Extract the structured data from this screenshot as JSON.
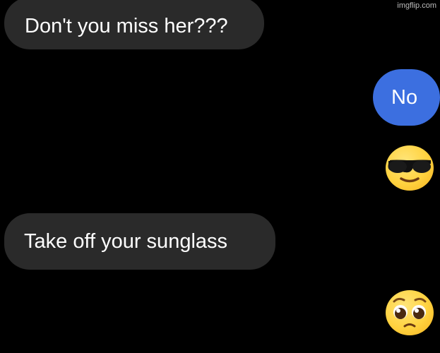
{
  "watermark": "imgflip.com",
  "messages": [
    {
      "side": "incoming",
      "text": "Don't you miss her???"
    },
    {
      "side": "outgoing",
      "text": "No"
    },
    {
      "side": "outgoing",
      "emoji": "smiling-face-with-sunglasses-icon"
    },
    {
      "side": "incoming",
      "text": "Take off your sunglass"
    },
    {
      "side": "outgoing",
      "emoji": "pleading-face-icon"
    }
  ],
  "colors": {
    "background": "#000000",
    "incoming_bubble": "#2a2a2a",
    "outgoing_bubble": "#3c6fe0",
    "text": "#ffffff"
  }
}
